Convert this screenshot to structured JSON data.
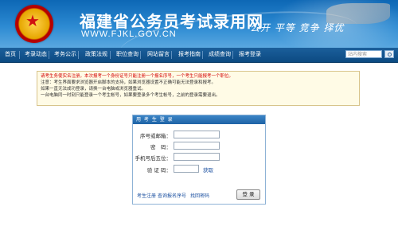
{
  "header": {
    "title": "福建省公务员考试录用网",
    "url": "WWW.FJKL.GOV.CN",
    "slogan": "公开 平等 竞争 择优"
  },
  "nav": {
    "items": [
      "首页",
      "考录动态",
      "考务公示",
      "政策法规",
      "职位查询",
      "网站留言",
      "报考指南",
      "成绩查询",
      "报考登录"
    ],
    "search_placeholder": "站内搜索"
  },
  "notice": {
    "line1": "请考生务使实名注册，本次报考一个身份证号只能注册一个报名序号，一个考生只能报考一个职位。",
    "line2": "注意：考生界面要求浏览器开启脚本的支持，如果浏览器设置不正确可能无法登录和报考。",
    "line3": "如果一直无法成功登录，请换一台电脑或浏览器重试。",
    "line4": "一台电脑同一时刻只能登录一个考生帐号，如果要登录多个考生帐号，之前的登录需要退出。"
  },
  "login": {
    "header": "用 考 生 登 录",
    "fields": {
      "serial_label": "序号或邮箱：",
      "password_label": "密　码：",
      "phone_label": "手机号后五位：",
      "captcha_label": "验 证 码："
    },
    "get_captcha": "获取",
    "links": {
      "register": "考生注册",
      "find_serial": "查询报名序号",
      "find_password": "找回密码"
    },
    "submit": "登 录"
  }
}
